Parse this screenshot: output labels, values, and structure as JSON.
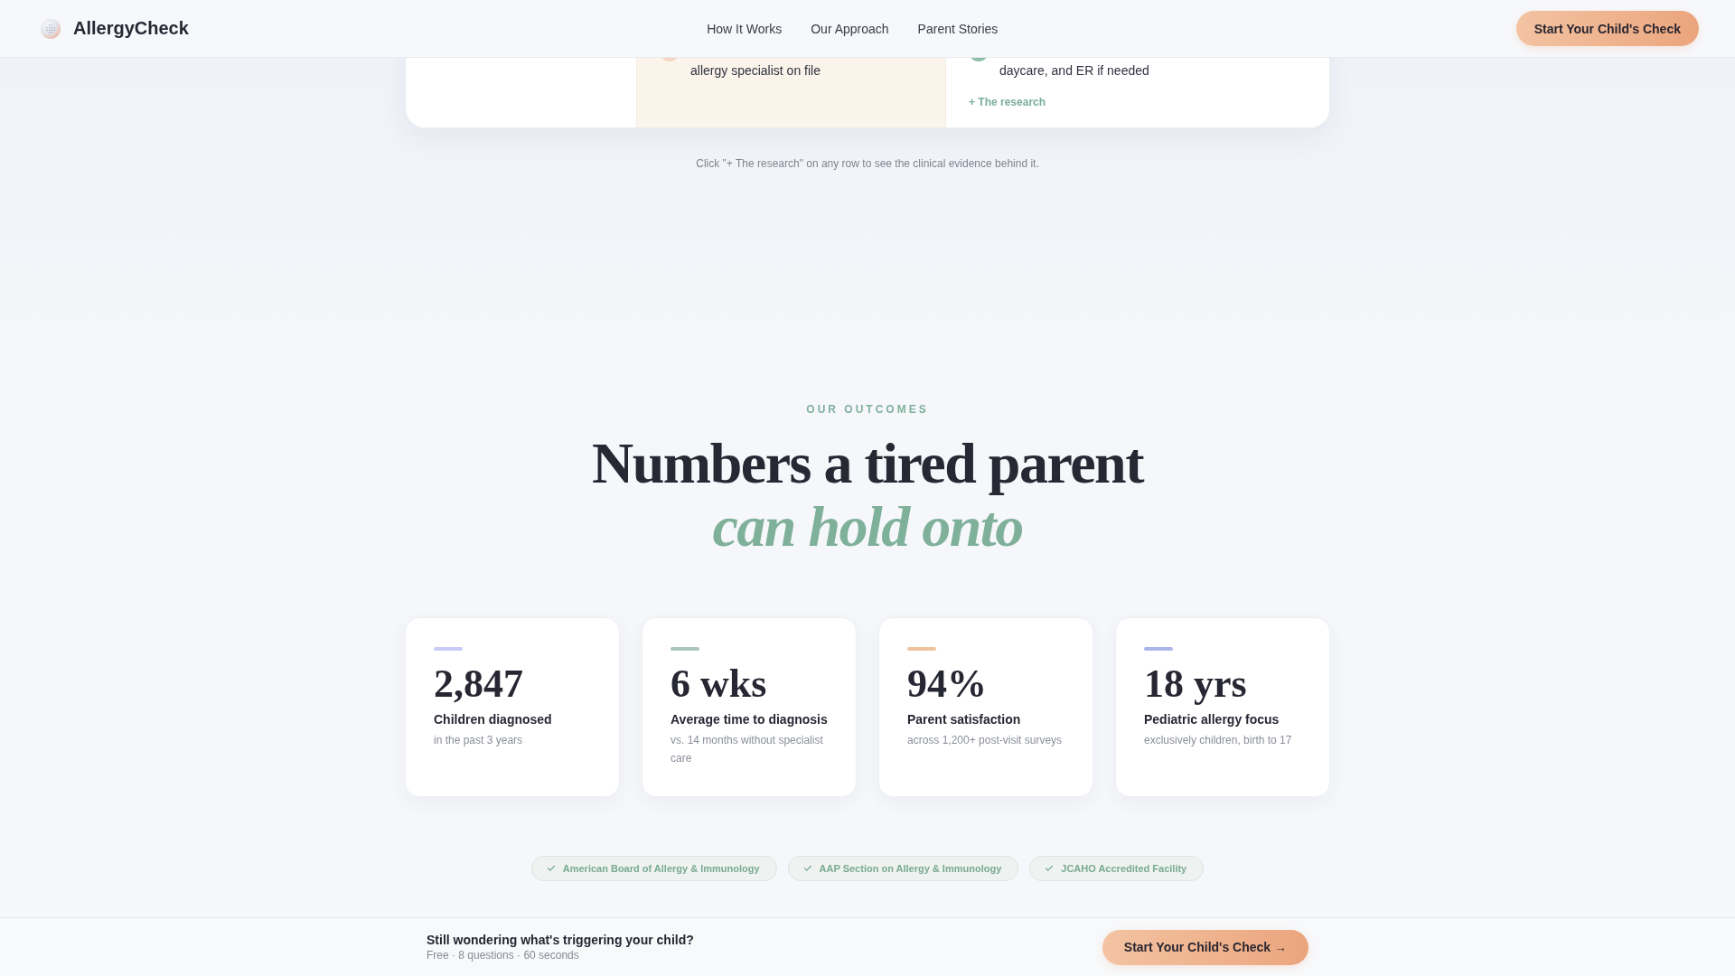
{
  "header": {
    "brand": "AllergyCheck",
    "nav": [
      "How It Works",
      "Our Approach",
      "Parent Stories"
    ],
    "cta": "Start Your Child's Check"
  },
  "comparison_card": {
    "steps": [
      {
        "text": "allergy specialist on file",
        "color": "#f5d5c2",
        "highlighted": true
      },
      {
        "text": "daycare, and ER if needed",
        "color": "#8dbea6",
        "highlighted": false,
        "link": "+ The research"
      }
    ]
  },
  "caption": "Click \"+ The research\" on any row to see the clinical evidence behind it.",
  "outcomes": {
    "eyebrow": "OUR OUTCOMES",
    "title": "Numbers a tired parent *can hold onto*",
    "stats": [
      {
        "value": "2,847",
        "label": "Children diagnosed",
        "note": "in the past 3 years",
        "color": "#c6ccf5"
      },
      {
        "value": "6 wks",
        "label": "Average time to diagnosis",
        "note": "vs. 14 months without specialist care",
        "color": "#a9c6b8"
      },
      {
        "value": "94%",
        "label": "Parent satisfaction",
        "note": "across 1,200+ post-visit surveys",
        "color": "#f0c39f"
      },
      {
        "value": "18 yrs",
        "label": "Pediatric allergy focus",
        "note": "exclusively children, birth to 17",
        "color": "#abb5ec"
      }
    ],
    "badges": [
      "American Board of Allergy & Immunology",
      "AAP Section on Allergy & Immunology",
      "JCAHO Accredited Facility"
    ]
  },
  "sticky_bar": {
    "title": "Still wondering what's triggering your child?",
    "subtitle": "Free · 8 questions · 60 seconds",
    "cta": "Start Your Child's Check →"
  }
}
